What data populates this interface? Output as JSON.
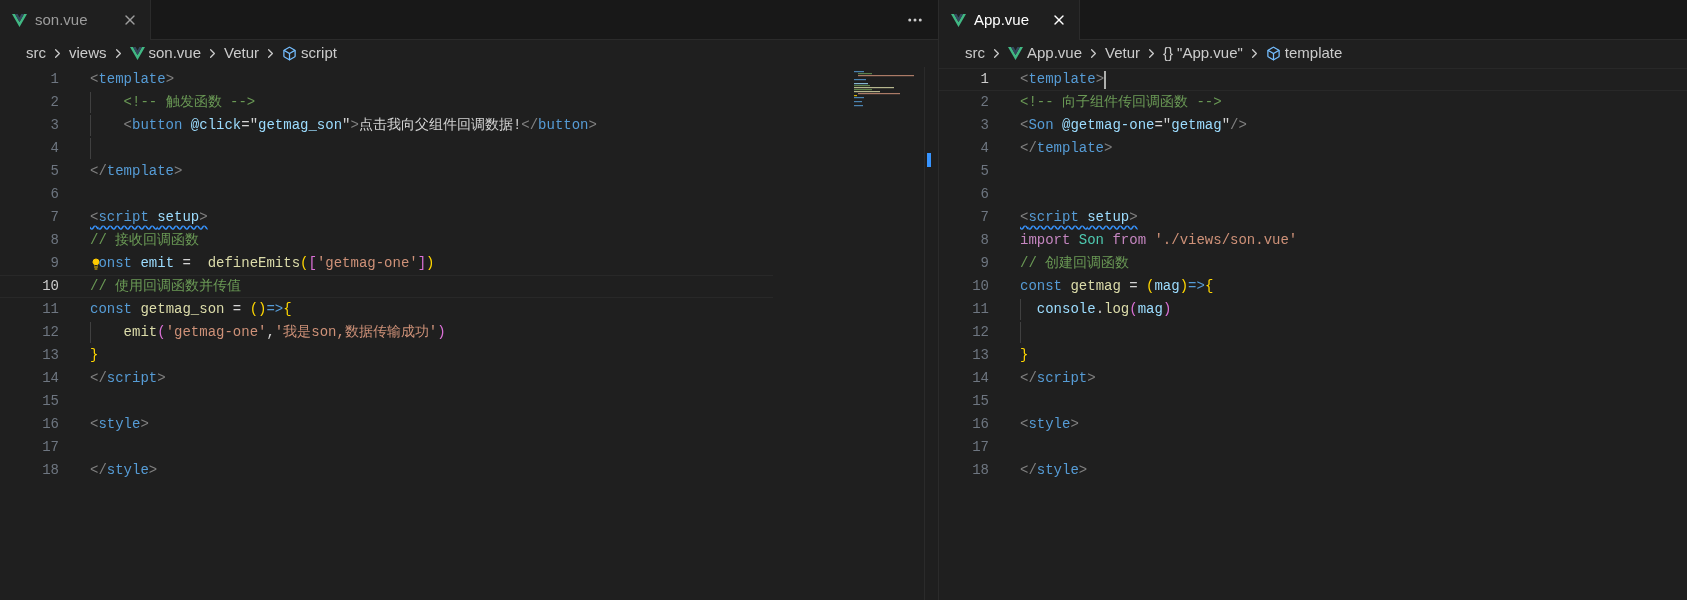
{
  "panes": [
    {
      "focused": false,
      "more_actions": true,
      "minimap": true,
      "tab": {
        "label": "son.vue",
        "selected": true
      },
      "breadcrumbs": [
        {
          "kind": "text",
          "label": "src"
        },
        {
          "kind": "text",
          "label": "views"
        },
        {
          "kind": "vue",
          "label": "son.vue"
        },
        {
          "kind": "text",
          "label": "Vetur"
        },
        {
          "kind": "cube",
          "label": "script"
        }
      ],
      "lines": [
        {
          "n": "1",
          "current": false,
          "tokens": [
            {
              "kind": "p",
              "text": "<"
            },
            {
              "kind": "tag",
              "text": "template"
            },
            {
              "kind": "p",
              "text": ">"
            }
          ]
        },
        {
          "n": "2",
          "current": false,
          "guide": true,
          "tokens": [
            {
              "kind": "cm",
              "text": "    <!-- 触发函数 -->"
            }
          ]
        },
        {
          "n": "3",
          "current": false,
          "guide": true,
          "tokens": [
            {
              "kind": "p",
              "text": "    <"
            },
            {
              "kind": "tag",
              "text": "button "
            },
            {
              "kind": "attr",
              "text": "@click"
            },
            {
              "kind": "tx",
              "text": "=\""
            },
            {
              "kind": "av",
              "text": "getmag_son"
            },
            {
              "kind": "tx",
              "text": "\""
            },
            {
              "kind": "p",
              "text": ">"
            },
            {
              "kind": "tx",
              "text": "点击我向父组件回调数据!"
            },
            {
              "kind": "p",
              "text": "</"
            },
            {
              "kind": "tag",
              "text": "button"
            },
            {
              "kind": "p",
              "text": ">"
            }
          ]
        },
        {
          "n": "4",
          "current": false,
          "guide": true
        },
        {
          "n": "5",
          "current": false,
          "tokens": [
            {
              "kind": "p",
              "text": "</"
            },
            {
              "kind": "tag",
              "text": "template"
            },
            {
              "kind": "p",
              "text": ">"
            }
          ]
        },
        {
          "n": "6",
          "current": false
        },
        {
          "n": "7",
          "current": false,
          "warn": true,
          "tokens": [
            {
              "kind": "p",
              "text": "<"
            },
            {
              "kind": "tag",
              "text": "script "
            },
            {
              "kind": "attr",
              "text": "setup"
            },
            {
              "kind": "p",
              "text": ">"
            }
          ]
        },
        {
          "n": "8",
          "current": false,
          "tokens": [
            {
              "kind": "cm",
              "text": "// 接收回调函数"
            }
          ]
        },
        {
          "n": "9",
          "current": false,
          "bulb": true,
          "tokens": [
            {
              "kind": "kw",
              "text": "onst "
            },
            {
              "kind": "var",
              "text": "emit"
            },
            {
              "kind": "tx",
              "text": " =  "
            },
            {
              "kind": "fn",
              "text": "defineEmits"
            },
            {
              "kind": "b1",
              "text": "("
            },
            {
              "kind": "b2",
              "text": "["
            },
            {
              "kind": "str",
              "text": "'getmag-one'"
            },
            {
              "kind": "b2",
              "text": "]"
            },
            {
              "kind": "b1",
              "text": ")"
            }
          ]
        },
        {
          "n": "10",
          "current": true,
          "tokens": [
            {
              "kind": "cm",
              "text": "// 使用回调函数并传值"
            }
          ]
        },
        {
          "n": "11",
          "current": false,
          "tokens": [
            {
              "kind": "kw",
              "text": "const "
            },
            {
              "kind": "fn",
              "text": "getmag_son"
            },
            {
              "kind": "tx",
              "text": " = "
            },
            {
              "kind": "b1",
              "text": "()"
            },
            {
              "kind": "kw",
              "text": "=>"
            },
            {
              "kind": "b1",
              "text": "{"
            }
          ]
        },
        {
          "n": "12",
          "current": false,
          "guide": true,
          "tokens": [
            {
              "kind": "fn",
              "text": "    emit"
            },
            {
              "kind": "b2",
              "text": "("
            },
            {
              "kind": "str",
              "text": "'getmag-one'"
            },
            {
              "kind": "tx",
              "text": ","
            },
            {
              "kind": "str",
              "text": "'我是son,数据传输成功'"
            },
            {
              "kind": "b2",
              "text": ")"
            }
          ]
        },
        {
          "n": "13",
          "current": false,
          "tokens": [
            {
              "kind": "b1",
              "text": "}"
            }
          ]
        },
        {
          "n": "14",
          "current": false,
          "tokens": [
            {
              "kind": "p",
              "text": "</"
            },
            {
              "kind": "tag",
              "text": "script"
            },
            {
              "kind": "p",
              "text": ">"
            }
          ]
        },
        {
          "n": "15",
          "current": false
        },
        {
          "n": "16",
          "current": false,
          "tokens": [
            {
              "kind": "p",
              "text": "<"
            },
            {
              "kind": "tag",
              "text": "style"
            },
            {
              "kind": "p",
              "text": ">"
            }
          ]
        },
        {
          "n": "17",
          "current": false
        },
        {
          "n": "18",
          "current": false,
          "tokens": [
            {
              "kind": "p",
              "text": "</"
            },
            {
              "kind": "tag",
              "text": "style"
            },
            {
              "kind": "p",
              "text": ">"
            }
          ]
        }
      ]
    },
    {
      "focused": true,
      "more_actions": false,
      "minimap": false,
      "tab": {
        "label": "App.vue",
        "selected": true
      },
      "breadcrumbs": [
        {
          "kind": "text",
          "label": "src"
        },
        {
          "kind": "vue",
          "label": "App.vue"
        },
        {
          "kind": "text",
          "label": "Vetur"
        },
        {
          "kind": "braces",
          "glyph": "{}",
          "label": "\"App.vue\""
        },
        {
          "kind": "cube",
          "label": "template"
        }
      ],
      "lines": [
        {
          "n": "1",
          "current": true,
          "tokens": [
            {
              "kind": "p",
              "text": "<"
            },
            {
              "kind": "tag",
              "text": "template"
            },
            {
              "kind": "p",
              "text": ">"
            }
          ]
        },
        {
          "n": "2",
          "current": false,
          "tokens": [
            {
              "kind": "cm",
              "text": "<!-- 向子组件传回调函数 -->"
            }
          ]
        },
        {
          "n": "3",
          "current": false,
          "tokens": [
            {
              "kind": "p",
              "text": "<"
            },
            {
              "kind": "tag",
              "text": "Son "
            },
            {
              "kind": "attr",
              "text": "@getmag-one"
            },
            {
              "kind": "tx",
              "text": "=\""
            },
            {
              "kind": "av",
              "text": "getmag"
            },
            {
              "kind": "tx",
              "text": "\""
            },
            {
              "kind": "p",
              "text": "/>"
            }
          ]
        },
        {
          "n": "4",
          "current": false,
          "tokens": [
            {
              "kind": "p",
              "text": "</"
            },
            {
              "kind": "tag",
              "text": "template"
            },
            {
              "kind": "p",
              "text": ">"
            }
          ]
        },
        {
          "n": "5",
          "current": false
        },
        {
          "n": "6",
          "current": false
        },
        {
          "n": "7",
          "current": false,
          "warn": true,
          "tokens": [
            {
              "kind": "p",
              "text": "<"
            },
            {
              "kind": "tag",
              "text": "script "
            },
            {
              "kind": "attr",
              "text": "setup"
            },
            {
              "kind": "p",
              "text": ">"
            }
          ]
        },
        {
          "n": "8",
          "current": false,
          "tokens": [
            {
              "kind": "imp",
              "text": "import "
            },
            {
              "kind": "cls",
              "text": "Son "
            },
            {
              "kind": "imp",
              "text": "from "
            },
            {
              "kind": "str",
              "text": "'./views/son.vue'"
            }
          ]
        },
        {
          "n": "9",
          "current": false,
          "tokens": [
            {
              "kind": "cm",
              "text": "// 创建回调函数"
            }
          ]
        },
        {
          "n": "10",
          "current": false,
          "tokens": [
            {
              "kind": "kw",
              "text": "const "
            },
            {
              "kind": "fn",
              "text": "getmag"
            },
            {
              "kind": "tx",
              "text": " = "
            },
            {
              "kind": "b1",
              "text": "("
            },
            {
              "kind": "var",
              "text": "mag"
            },
            {
              "kind": "b1",
              "text": ")"
            },
            {
              "kind": "kw",
              "text": "=>"
            },
            {
              "kind": "b1",
              "text": "{"
            }
          ]
        },
        {
          "n": "11",
          "current": false,
          "guide": true,
          "tokens": [
            {
              "kind": "var",
              "text": "  console"
            },
            {
              "kind": "tx",
              "text": "."
            },
            {
              "kind": "fn",
              "text": "log"
            },
            {
              "kind": "b2",
              "text": "("
            },
            {
              "kind": "var",
              "text": "mag"
            },
            {
              "kind": "b2",
              "text": ")"
            }
          ]
        },
        {
          "n": "12",
          "current": false,
          "guide": true
        },
        {
          "n": "13",
          "current": false,
          "tokens": [
            {
              "kind": "b1",
              "text": "}"
            }
          ]
        },
        {
          "n": "14",
          "current": false,
          "tokens": [
            {
              "kind": "p",
              "text": "</"
            },
            {
              "kind": "tag",
              "text": "script"
            },
            {
              "kind": "p",
              "text": ">"
            }
          ]
        },
        {
          "n": "15",
          "current": false
        },
        {
          "n": "16",
          "current": false,
          "tokens": [
            {
              "kind": "p",
              "text": "<"
            },
            {
              "kind": "tag",
              "text": "style"
            },
            {
              "kind": "p",
              "text": ">"
            }
          ]
        },
        {
          "n": "17",
          "current": false
        },
        {
          "n": "18",
          "current": false,
          "tokens": [
            {
              "kind": "p",
              "text": "</"
            },
            {
              "kind": "tag",
              "text": "style"
            },
            {
              "kind": "p",
              "text": ">"
            }
          ]
        }
      ]
    }
  ]
}
